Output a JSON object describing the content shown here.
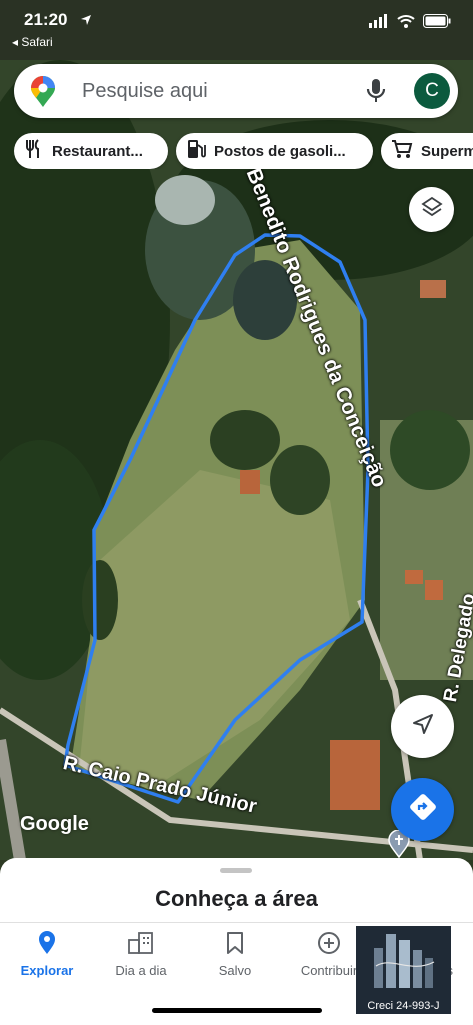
{
  "status_bar": {
    "time": "21:20",
    "back_app": "◂ Safari"
  },
  "search": {
    "placeholder": "Pesquise aqui",
    "avatar_initial": "C"
  },
  "chips": [
    {
      "label": "Restaurant...",
      "icon": "fork-knife-icon"
    },
    {
      "label": "Postos de gasoli...",
      "icon": "gas-station-icon"
    },
    {
      "label": "Superm",
      "icon": "cart-icon"
    }
  ],
  "map": {
    "street_labels": [
      "Benedito Rodrigues da Conceição",
      "R. Caio Prado Júnior",
      "R. Delegado"
    ],
    "attribution": "Google",
    "outline_color": "#2f7ff0"
  },
  "sheet": {
    "title": "Conheça a área"
  },
  "nav": [
    {
      "label": "Explorar",
      "active": true
    },
    {
      "label": "Dia a dia",
      "active": false
    },
    {
      "label": "Salvo",
      "active": false
    },
    {
      "label": "Contribuir",
      "active": false
    },
    {
      "label": "s",
      "active": false
    }
  ],
  "watermark": {
    "caption": "Creci 24-993-J"
  }
}
